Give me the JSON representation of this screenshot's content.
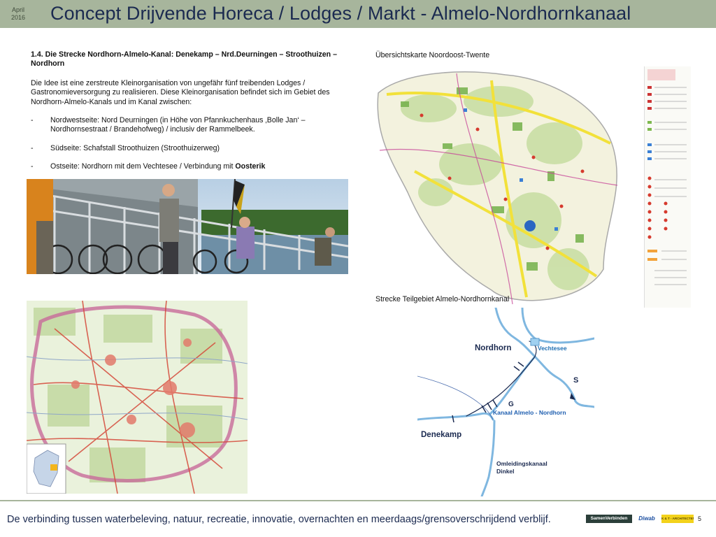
{
  "header": {
    "date_month": "April",
    "date_year": "2016",
    "title": "Concept  Drijvende  Horeca / Lodges / Markt   -   Almelo-Nordhornkanaal"
  },
  "content": {
    "section_heading": "1.4.   Die Strecke Nordhorn-Almelo-Kanal: Denekamp – Nrd.Deurningen – Stroothuizen –Nordhorn",
    "intro": "Die Idee ist eine zerstreute Kleinorganisation von ungefähr fünf treibenden Lodges / Gastronomieversorgung zu realisieren. Diese Kleinorganisation befindet sich im Gebiet des Nordhorn-Almelo-Kanals und im Kanal zwischen:",
    "bullets": [
      "Nordwestseite: Nord Deurningen (in Höhe von Pfannkuchenhaus ‚Bolle Jan‘ – Nordhornsestraat / Brandehofweg) / inclusiv der Rammelbeek.",
      "Südseite: Schafstall Stroothuizen (Stroothuizerweg)"
    ],
    "bullet3_prefix": "Ostseite: Nordhorn mit dem Vechtesee / Verbindung mit ",
    "bullet3_bold": "Oosterik",
    "bullet_dash": "-"
  },
  "captions": {
    "overview_map": "Übersichtskarte Noordoost-Twente",
    "route_map": "Strecke Teilgebiet Almelo-Nordhornkanal"
  },
  "route_map": {
    "nordhorn": "Nordhorn",
    "vechtesee": "Vechtesee",
    "s_marker": "S",
    "g_marker": "G",
    "kanaal": "Kanaal Almelo - Nordhorn",
    "denekamp": "Denekamp",
    "omleiding_line1": "Omleidingskanaal",
    "omleiding_line2": "Dinkel"
  },
  "footer": {
    "tagline": "De verbinding tussen waterbeleving, natuur, recreatie, innovatie, overnachten en meerdaags/grensoverschrijdend verblijf.",
    "page_number": "5",
    "logo1": "SamenVerbinden",
    "logo2": "Diwab",
    "logo3": "K & T - ARCHITECTEN"
  },
  "colors": {
    "header_band": "#a7b59c",
    "title_text": "#1b2a50",
    "route_water": "#7fb7e0",
    "overview_route": "#f2e13a"
  }
}
